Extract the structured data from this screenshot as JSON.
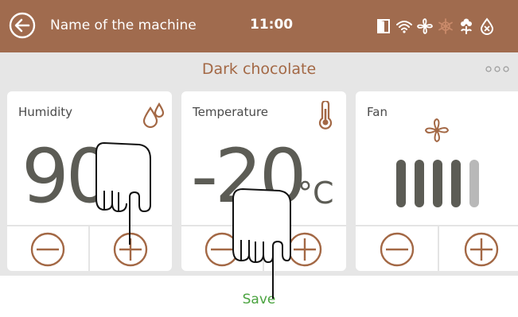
{
  "header": {
    "machine_name": "Name of the machine",
    "time": "11:00",
    "back_icon": "arrow-left-circle-icon",
    "status_icons": [
      "door-icon",
      "wifi-icon",
      "fan-icon",
      "snowflake-icon",
      "flower-icon",
      "water-drop-icon"
    ]
  },
  "title": "Dark chocolate",
  "more_icon": "more-dots-icon",
  "cards": {
    "humidity": {
      "label": "Humidity",
      "value": "90",
      "icon": "water-drops-icon"
    },
    "temperature": {
      "label": "Temperature",
      "value": "-20",
      "unit": "°C",
      "icon": "thermometer-icon"
    },
    "fan": {
      "label": "Fan",
      "icon": "fan-icon",
      "level": 4,
      "max_level": 5
    }
  },
  "save_label": "Save",
  "colors": {
    "header_bg": "#a06b4e",
    "accent": "#a36845",
    "save_green": "#4aa33f",
    "value_gray": "#5c5c55",
    "fan_inactive": "#b8b8b8"
  }
}
